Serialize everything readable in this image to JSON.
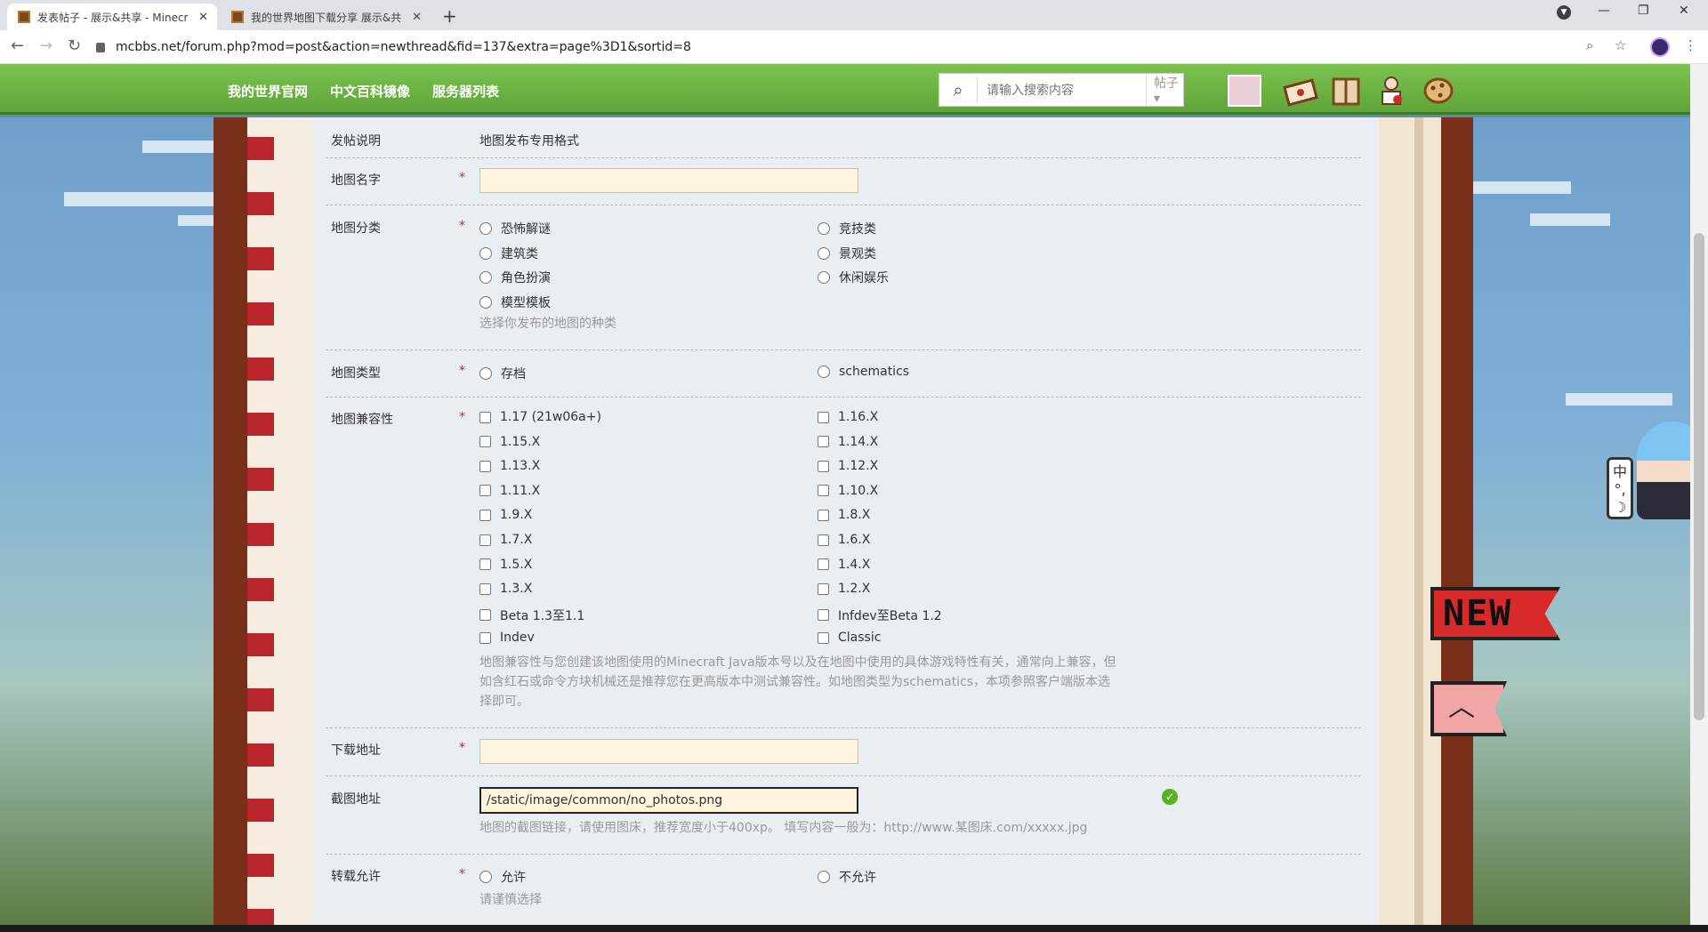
{
  "browser": {
    "tabs": [
      {
        "title": "发表帖子 - 展示&共享 - Minecr",
        "active": true
      },
      {
        "title": "我的世界地图下载分享 展示&共",
        "active": false
      }
    ],
    "new_tab": "+",
    "url": "mcbbs.net/forum.php?mod=post&action=newthread&fid=137&extra=page%3D1&sortid=8"
  },
  "site": {
    "nav": [
      "我的世界官网",
      "中文百科镜像",
      "服务器列表"
    ],
    "search": {
      "placeholder": "请输入搜索内容",
      "type": "帖子"
    }
  },
  "form": {
    "notice": {
      "label": "发帖说明",
      "value": "地图发布专用格式"
    },
    "map_name": {
      "label": "地图名字",
      "required": "*",
      "value": ""
    },
    "map_category": {
      "label": "地图分类",
      "required": "*",
      "options_left": [
        "恐怖解谜",
        "建筑类",
        "角色扮演",
        "模型模板"
      ],
      "options_right": [
        "竞技类",
        "景观类",
        "休闲娱乐"
      ],
      "hint": "选择你发布的地图的种类"
    },
    "map_type": {
      "label": "地图类型",
      "required": "*",
      "options": [
        "存档",
        "schematics"
      ]
    },
    "compat": {
      "label": "地图兼容性",
      "required": "*",
      "left": [
        "1.17 (21w06a+)",
        "1.15.X",
        "1.13.X",
        "1.11.X",
        "1.9.X",
        "1.7.X",
        "1.5.X",
        "1.3.X",
        "Beta 1.3至1.1",
        "Indev"
      ],
      "right": [
        "1.16.X",
        "1.14.X",
        "1.12.X",
        "1.10.X",
        "1.8.X",
        "1.6.X",
        "1.4.X",
        "1.2.X",
        "Infdev至Beta 1.2",
        "Classic"
      ],
      "hint_lines": [
        "地图兼容性与您创建该地图使用的Minecraft Java版本号以及在地图中使用的具体游戏特性有关，通常向上兼容，但",
        "如含红石或命令方块机械还是推荐您在更高版本中测试兼容性。如地图类型为schematics，本项参照客户端版本选",
        "择即可。"
      ]
    },
    "download": {
      "label": "下载地址",
      "required": "*",
      "value": ""
    },
    "screenshot": {
      "label": "截图地址",
      "value": "/static/image/common/no_photos.png",
      "hint": "地图的截图链接，请使用图床，推荐宽度小于400xp。 填写内容一般为：http://www.某图床.com/xxxxx.jpg"
    },
    "repost": {
      "label": "转载允许",
      "required": "*",
      "options": [
        "允许",
        "不允许"
      ],
      "hint": "请谨慎选择"
    }
  },
  "decor": {
    "new_badge": "NEW",
    "ime": [
      "中",
      "°,",
      "☽"
    ]
  }
}
